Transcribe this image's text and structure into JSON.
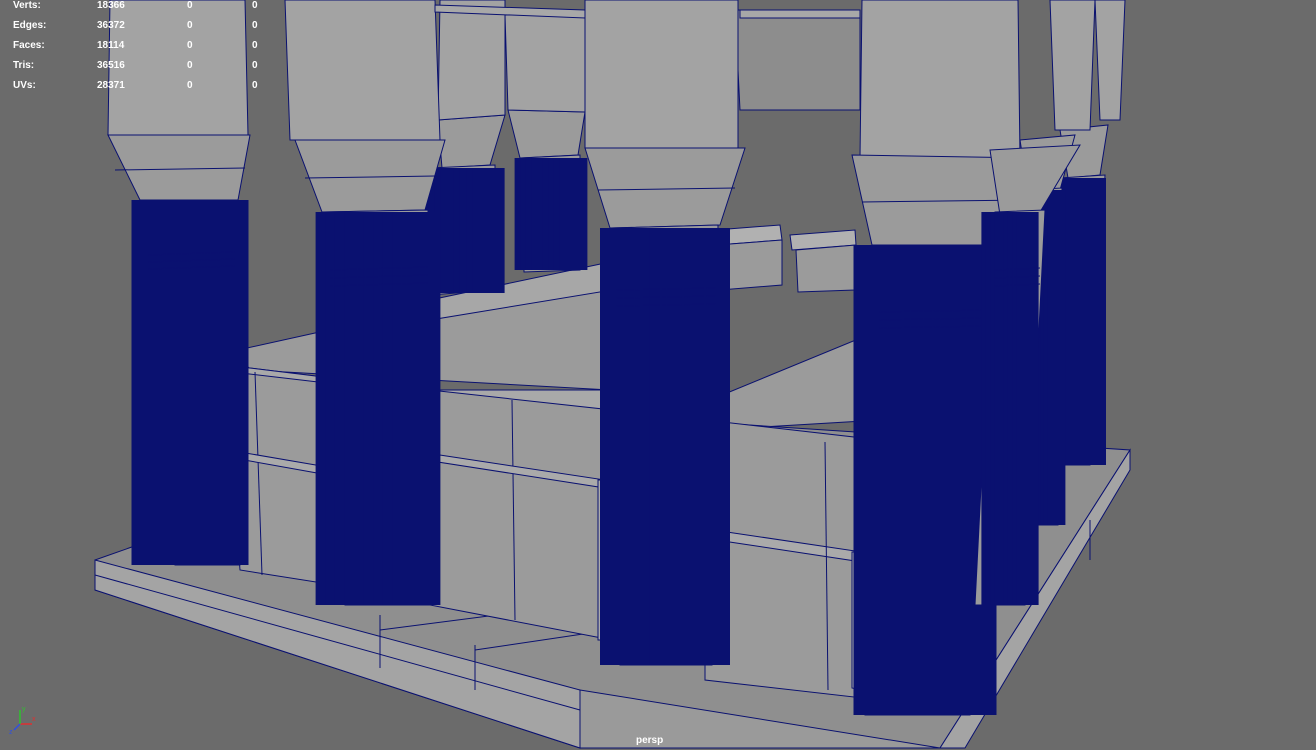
{
  "hud": {
    "rows": [
      {
        "label": "Verts:",
        "v1": "18366",
        "v2": "0",
        "v3": "0"
      },
      {
        "label": "Edges:",
        "v1": "36372",
        "v2": "0",
        "v3": "0"
      },
      {
        "label": "Faces:",
        "v1": "18114",
        "v2": "0",
        "v3": "0"
      },
      {
        "label": "Tris:",
        "v1": "36516",
        "v2": "0",
        "v3": "0"
      },
      {
        "label": "UVs:",
        "v1": "28371",
        "v2": "0",
        "v3": "0"
      }
    ]
  },
  "camera": {
    "name": "persp"
  },
  "axis": {
    "x": "x",
    "y": "y",
    "z": "z"
  },
  "colors": {
    "background": "#6b6b6b",
    "geometry": "#9b9b9b",
    "wireframe": "#0a1170",
    "hud_text": "#ffffff"
  }
}
